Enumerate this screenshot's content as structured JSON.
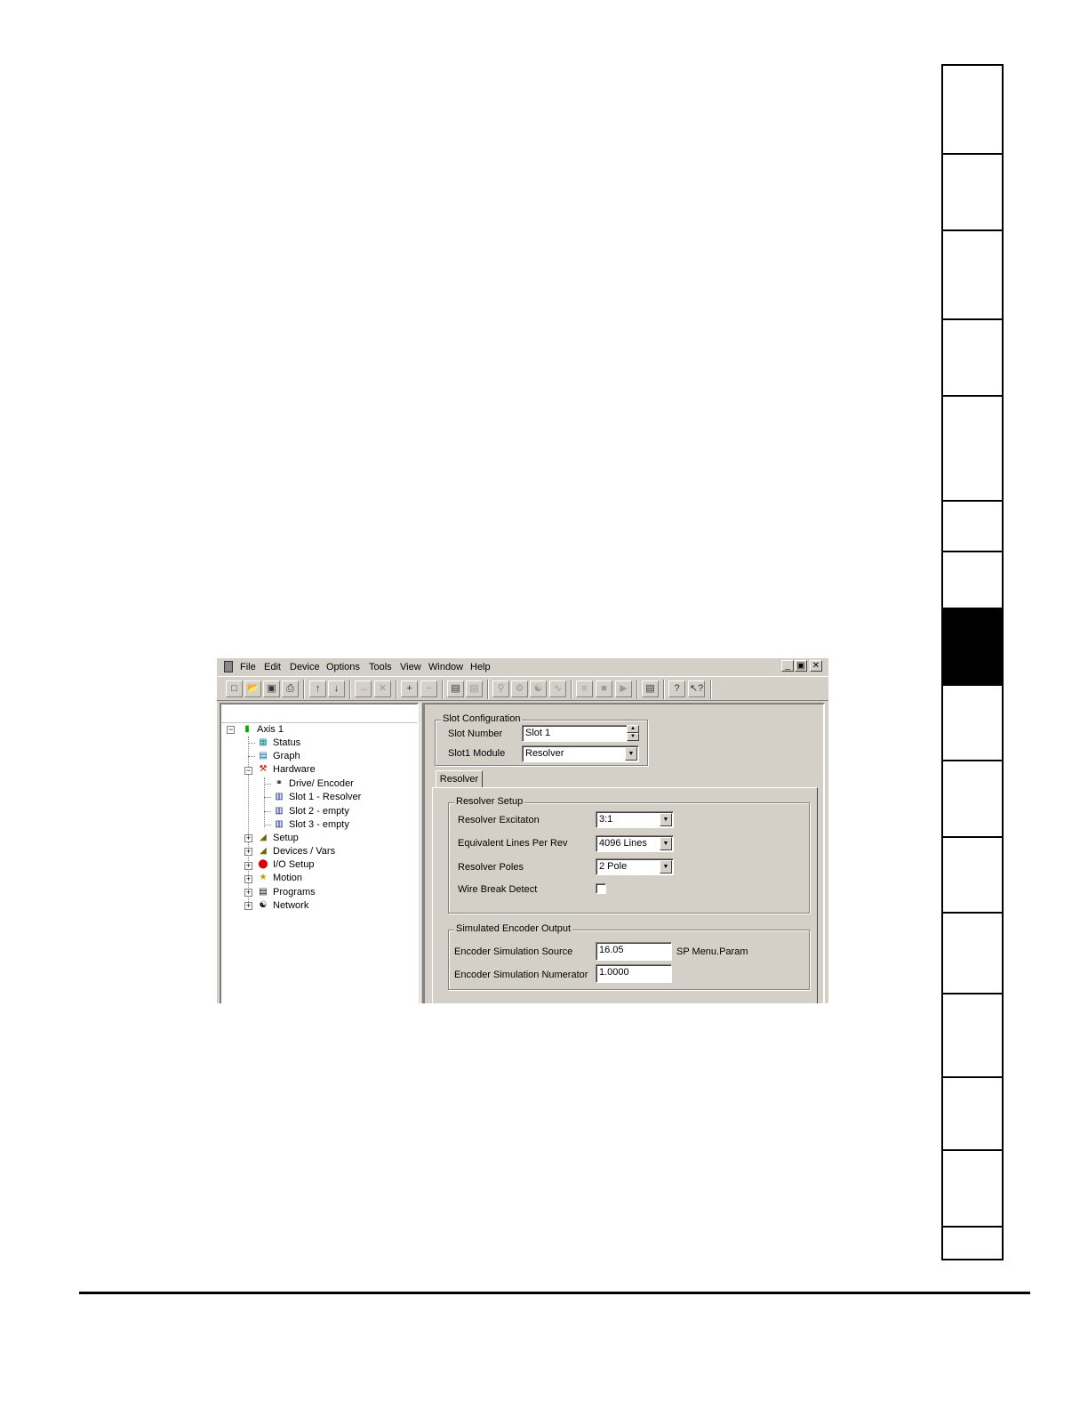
{
  "window": {
    "menu": [
      "File",
      "Edit",
      "Device",
      "Options",
      "Tools",
      "View",
      "Window",
      "Help"
    ],
    "controls": {
      "minimize_icon": "minimize-icon",
      "restore_icon": "restore-icon",
      "close_icon": "close-icon"
    }
  },
  "toolbar": {
    "icons": [
      "new-file-icon",
      "open-folder-icon",
      "save-icon",
      "print-icon",
      "upload-icon",
      "download-icon",
      "goto-param-icon",
      "delete-icon",
      "add-node-icon",
      "remove-node-icon",
      "copy-icon",
      "paste-icon",
      "zoom-icon",
      "config-icon",
      "watch-icon",
      "scope-icon",
      "compile-icon",
      "stop-icon",
      "run-icon",
      "window-icon",
      "help-icon",
      "context-help-icon"
    ]
  },
  "tree": {
    "root": "Axis 1",
    "items": [
      {
        "label": "Status",
        "icon": "status-icon"
      },
      {
        "label": "Graph",
        "icon": "graph-icon"
      },
      {
        "label": "Hardware",
        "icon": "hardware-icon"
      },
      {
        "label": "Drive/ Encoder",
        "icon": "encoder-icon"
      },
      {
        "label": "Slot 1 - Resolver",
        "icon": "slot-icon"
      },
      {
        "label": "Slot 2 - empty",
        "icon": "slot-icon"
      },
      {
        "label": "Slot 3 - empty",
        "icon": "slot-icon"
      },
      {
        "label": "Setup",
        "icon": "setup-icon"
      },
      {
        "label": "Devices / Vars",
        "icon": "devices-icon"
      },
      {
        "label": "I/O Setup",
        "icon": "io-icon"
      },
      {
        "label": "Motion",
        "icon": "motion-icon"
      },
      {
        "label": "Programs",
        "icon": "programs-icon"
      },
      {
        "label": "Network",
        "icon": "network-icon"
      }
    ]
  },
  "slot_config": {
    "title": "Slot Configuration",
    "slot_number_label": "Slot Number",
    "slot_number_value": "Slot 1",
    "module_label": "Slot1 Module",
    "module_value": "Resolver"
  },
  "tab": {
    "label": "Resolver"
  },
  "resolver_setup": {
    "title": "Resolver Setup",
    "excitation_label": "Resolver Excitaton",
    "excitation_value": "3:1",
    "lines_label": "Equivalent Lines Per Rev",
    "lines_value": "4096 Lines",
    "poles_label": "Resolver Poles",
    "poles_value": "2 Pole",
    "wire_break_label": "Wire Break Detect",
    "wire_break_checked": false
  },
  "encoder_output": {
    "title": "Simulated Encoder Output",
    "source_label": "Encoder Simulation Source",
    "source_value": "16.05",
    "source_unit": "SP Menu.Param",
    "numerator_label": "Encoder Simulation Numerator",
    "numerator_value": "1.0000"
  }
}
